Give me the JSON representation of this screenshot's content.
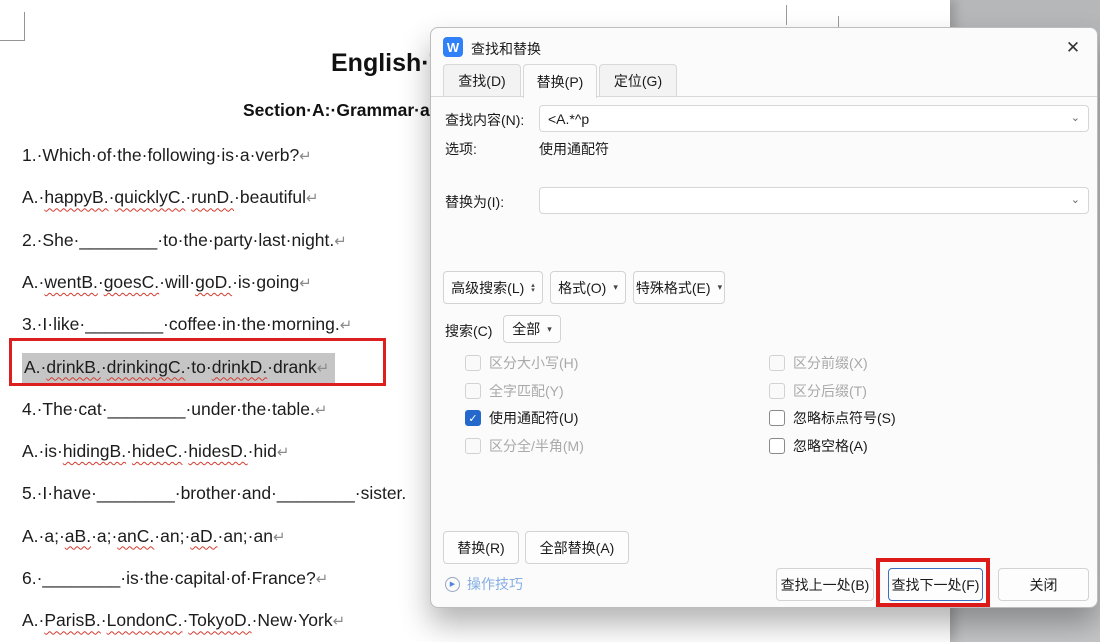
{
  "document": {
    "title": "English·T",
    "subtitle": "Section·A:·Grammar·a",
    "lines": [
      {
        "segments": [
          {
            "t": "1.·Which·of·the·following·is·a·verb?"
          },
          {
            "t": "↵",
            "mark": true
          }
        ]
      },
      {
        "segments": [
          {
            "t": "A.·"
          },
          {
            "t": "happyB.",
            "sp": true
          },
          {
            "t": "·"
          },
          {
            "t": "quicklyC.",
            "sp": true
          },
          {
            "t": "·"
          },
          {
            "t": "runD.",
            "sp": true
          },
          {
            "t": "·beautiful"
          },
          {
            "t": "↵",
            "mark": true
          }
        ]
      },
      {
        "segments": [
          {
            "t": "2.·She·________·to·the·party·last·night."
          },
          {
            "t": "↵",
            "mark": true
          }
        ]
      },
      {
        "segments": [
          {
            "t": "A.·"
          },
          {
            "t": "wentB.",
            "sp": true
          },
          {
            "t": "·"
          },
          {
            "t": "goesC.",
            "sp": true
          },
          {
            "t": "·will·"
          },
          {
            "t": "goD.",
            "sp": true
          },
          {
            "t": "·is·going"
          },
          {
            "t": "↵",
            "mark": true
          }
        ]
      },
      {
        "segments": [
          {
            "t": "3.·I·like·________·coffee·in·the·morning."
          },
          {
            "t": "↵",
            "mark": true
          }
        ]
      },
      {
        "selected": true,
        "segments": [
          {
            "t": "A.·"
          },
          {
            "t": "drinkB.",
            "sp": true
          },
          {
            "t": "·"
          },
          {
            "t": "drinkingC.",
            "sp": true
          },
          {
            "t": "·to·"
          },
          {
            "t": "drinkD.",
            "sp": true
          },
          {
            "t": "·drank"
          },
          {
            "t": "↵",
            "mark": true
          }
        ]
      },
      {
        "segments": [
          {
            "t": "4.·The·cat·________·under·the·table."
          },
          {
            "t": "↵",
            "mark": true
          }
        ]
      },
      {
        "segments": [
          {
            "t": "A.·is·"
          },
          {
            "t": "hidingB.",
            "sp": true
          },
          {
            "t": "·"
          },
          {
            "t": "hideC.",
            "sp": true
          },
          {
            "t": "·"
          },
          {
            "t": "hidesD.",
            "sp": true
          },
          {
            "t": "·hid"
          },
          {
            "t": "↵",
            "mark": true
          }
        ]
      },
      {
        "segments": [
          {
            "t": "5.·I·have·________·brother·and·________·sister."
          }
        ]
      },
      {
        "segments": [
          {
            "t": "A.·a;·"
          },
          {
            "t": "aB.",
            "sp": true
          },
          {
            "t": "·a;·"
          },
          {
            "t": "anC.",
            "sp": true
          },
          {
            "t": "·an;·"
          },
          {
            "t": "aD.",
            "sp": true
          },
          {
            "t": "·an;·an"
          },
          {
            "t": "↵",
            "mark": true
          }
        ]
      },
      {
        "segments": [
          {
            "t": "6.·________·is·the·capital·of·France?"
          },
          {
            "t": "↵",
            "mark": true
          }
        ]
      },
      {
        "segments": [
          {
            "t": "A.·"
          },
          {
            "t": "ParisB.",
            "sp": true
          },
          {
            "t": "·"
          },
          {
            "t": "LondonC.",
            "sp": true
          },
          {
            "t": "·"
          },
          {
            "t": "TokyoD.",
            "sp": true
          },
          {
            "t": "·New·York"
          },
          {
            "t": "↵",
            "mark": true
          }
        ]
      }
    ]
  },
  "dialog": {
    "app_icon_letter": "W",
    "title": "查找和替换",
    "close_glyph": "✕",
    "tabs": [
      {
        "key": "find",
        "label": "查找(D)",
        "active": false
      },
      {
        "key": "replace",
        "label": "替换(P)",
        "active": true
      },
      {
        "key": "goto",
        "label": "定位(G)",
        "active": false
      }
    ],
    "find_label": "查找内容(N):",
    "find_value": "<A.*^p",
    "options_label": "选项:",
    "options_value": "使用通配符",
    "replace_label": "替换为(I):",
    "replace_value": "",
    "advanced_button": "高级搜索(L)",
    "format_button": "格式(O)",
    "special_button": "特殊格式(E)",
    "search_label": "搜索(C)",
    "search_value": "全部",
    "checkboxes": {
      "left": [
        {
          "key": "match-case",
          "label": "区分大小写(H)",
          "state": "disabled"
        },
        {
          "key": "whole-word",
          "label": "全字匹配(Y)",
          "state": "disabled"
        },
        {
          "key": "use-wildcards",
          "label": "使用通配符(U)",
          "state": "checked"
        },
        {
          "key": "full-half-width",
          "label": "区分全/半角(M)",
          "state": "disabled"
        }
      ],
      "right": [
        {
          "key": "match-prefix",
          "label": "区分前缀(X)",
          "state": "disabled"
        },
        {
          "key": "match-suffix",
          "label": "区分后缀(T)",
          "state": "disabled"
        },
        {
          "key": "ignore-punctuation",
          "label": "忽略标点符号(S)",
          "state": "unchecked"
        },
        {
          "key": "ignore-whitespace",
          "label": "忽略空格(A)",
          "state": "unchecked"
        }
      ]
    },
    "replace_button": "替换(R)",
    "replace_all_button": "全部替换(A)",
    "tips_label": "操作技巧",
    "find_prev_button": "查找上一处(B)",
    "find_next_button": "查找下一处(F)",
    "close_button": "关闭",
    "check_glyph": "✓",
    "accent_blue": "#2468cb",
    "annotation_red": "#dc2020"
  }
}
